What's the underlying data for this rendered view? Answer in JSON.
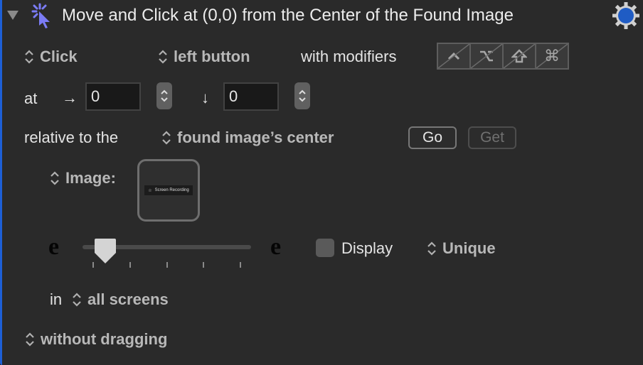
{
  "header": {
    "title": "Move and Click at (0,0) from the Center of the Found Image",
    "icon": "cursor-click-icon",
    "accent_color": "#7b7cf5",
    "gear_color": "#1f5cc4"
  },
  "row1": {
    "action_popup": "Click",
    "button_popup": "left button",
    "modifiers_label": "with modifiers",
    "modifiers": [
      {
        "name": "control",
        "glyph": "^"
      },
      {
        "name": "option",
        "glyph": "⌥"
      },
      {
        "name": "shift",
        "glyph": "⇧"
      },
      {
        "name": "command",
        "glyph": "⌘"
      }
    ]
  },
  "row2": {
    "at_label": "at",
    "h_arrow": "→",
    "h_value": "0",
    "v_arrow": "↓",
    "v_value": "0"
  },
  "row3": {
    "label": "relative to the",
    "relative_popup": "found image’s center",
    "go_label": "Go",
    "get_label": "Get"
  },
  "image": {
    "popup_label": "Image:",
    "thumbnail_text": "Screen Recording"
  },
  "fuzz": {
    "left_glyph": "e",
    "right_glyph": "e",
    "slider_value_fraction": 0.07,
    "tick_count": 5,
    "display_label": "Display",
    "display_checked": false,
    "unique_popup": "Unique"
  },
  "screens": {
    "in_label": "in",
    "screens_popup": "all screens"
  },
  "drag": {
    "drag_popup": "without dragging"
  }
}
